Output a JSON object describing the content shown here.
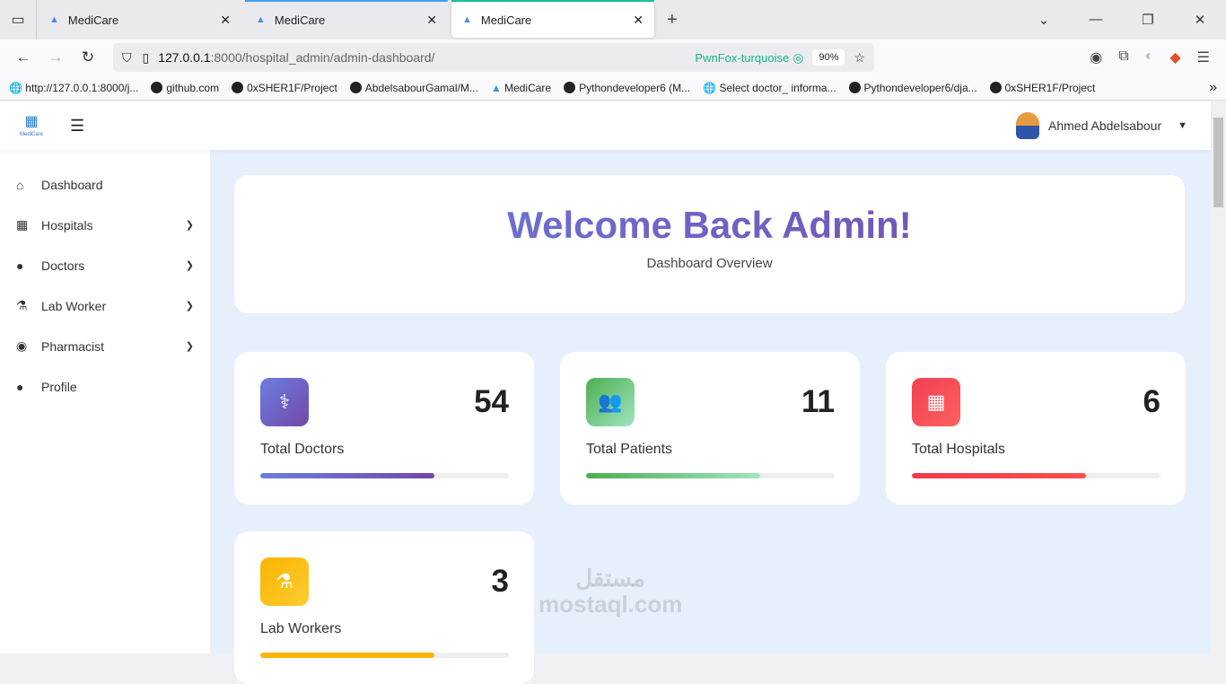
{
  "browser": {
    "tabs": [
      {
        "title": "MediCare"
      },
      {
        "title": "MediCare"
      },
      {
        "title": "MediCare"
      }
    ],
    "url_host": "127.0.0.1",
    "url_path": ":8000/hospital_admin/admin-dashboard/",
    "container": "PwnFox-turquoise",
    "zoom": "90%",
    "bookmarks": [
      "http://127.0.0.1:8000/j...",
      "github.com",
      "0xSHER1F/Project",
      "AbdelsabourGamal/M...",
      "MediCare",
      "Pythondeveloper6 (M...",
      "Select doctor_ informa...",
      "Pythondeveloper6/dja...",
      "0xSHER1F/Project"
    ]
  },
  "app": {
    "logo_text": "MediCare",
    "user_name": "Ahmed Abdelsabour"
  },
  "sidebar": {
    "items": [
      {
        "label": "Dashboard",
        "icon": "home-icon"
      },
      {
        "label": "Hospitals",
        "icon": "hospital-icon"
      },
      {
        "label": "Doctors",
        "icon": "doctor-icon"
      },
      {
        "label": "Lab Worker",
        "icon": "flask-icon"
      },
      {
        "label": "Pharmacist",
        "icon": "pills-icon"
      },
      {
        "label": "Profile",
        "icon": "user-icon"
      }
    ]
  },
  "welcome": {
    "title": "Welcome Back Admin!",
    "subtitle": "Dashboard Overview"
  },
  "stats": [
    {
      "label": "Total Doctors",
      "value": "54",
      "progress": 70,
      "color": "#6a6fd8"
    },
    {
      "label": "Total Patients",
      "value": "11",
      "progress": 70,
      "color": "#5ab04a"
    },
    {
      "label": "Total Hospitals",
      "value": "6",
      "progress": 70,
      "color": "#f03a4a"
    },
    {
      "label": "Lab Workers",
      "value": "3",
      "progress": 70,
      "color": "#f8b400"
    }
  ],
  "watermark": {
    "arabic": "مستقل",
    "latin": "mostaql.com"
  }
}
